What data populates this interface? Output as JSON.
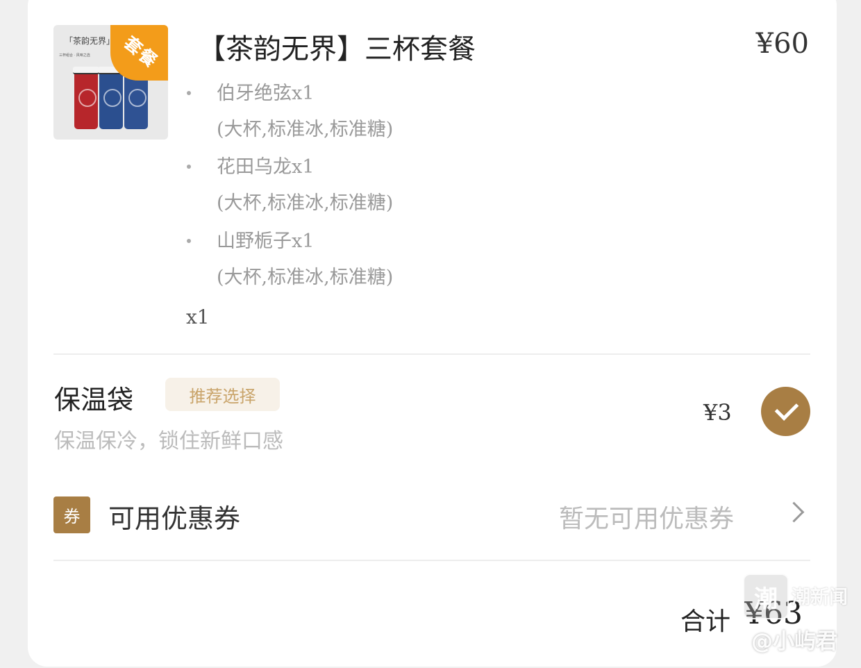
{
  "product": {
    "name": "【茶韵无界】三杯套餐",
    "price": "¥60",
    "quantity": "x1",
    "badge": "套餐",
    "image": {
      "title": "「茶韵无界」",
      "subtitle": "三杯组合 · 风味之选"
    },
    "items": [
      {
        "name": "伯牙绝弦x1",
        "options": "(大杯,标准冰,标准糖)"
      },
      {
        "name": "花田乌龙x1",
        "options": "(大杯,标准冰,标准糖)"
      },
      {
        "name": "山野栀子x1",
        "options": "(大杯,标准冰,标准糖)"
      }
    ]
  },
  "insulated_bag": {
    "title": "保温袋",
    "tag": "推荐选择",
    "description": "保温保冷，锁住新鲜口感",
    "price": "¥3",
    "selected": true
  },
  "coupon": {
    "icon_text": "券",
    "label": "可用优惠券",
    "status": "暂无可用优惠券"
  },
  "total": {
    "label": "合计",
    "value": "¥63"
  },
  "watermark": {
    "logo_text": "潮",
    "name": "潮新闻",
    "handle": "@小屿君"
  },
  "colors": {
    "accent": "#a87e44",
    "badge": "#f39c1a",
    "tag_bg": "#f7f1e8"
  }
}
